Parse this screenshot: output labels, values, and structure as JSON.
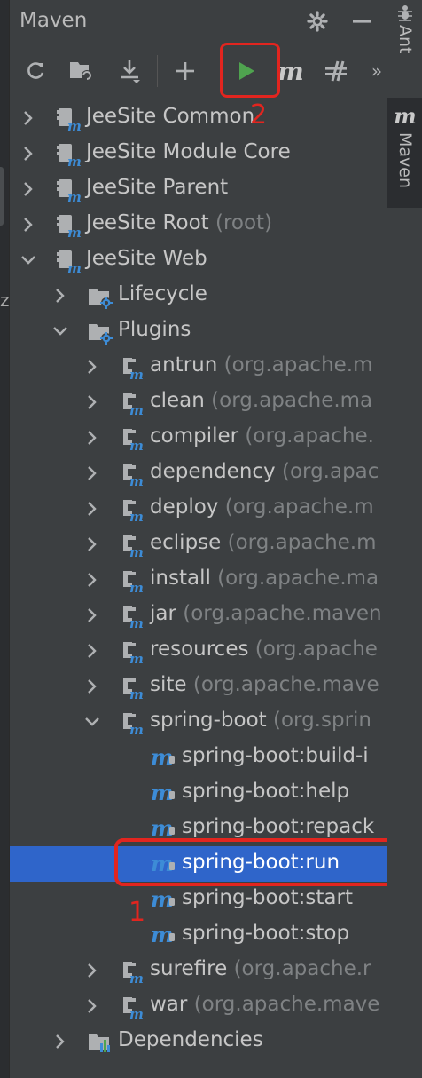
{
  "header": {
    "title": "Maven"
  },
  "toolbar": {
    "buttons": [
      "reload",
      "generate-sources",
      "download",
      "add",
      "run",
      "execute-goal",
      "skip-tests"
    ],
    "more": "»"
  },
  "left_strip": {
    "glyph": "z"
  },
  "side_tabs": [
    {
      "label": "Ant"
    },
    {
      "label": "Maven"
    }
  ],
  "tree": [
    {
      "label": "JeeSite Common",
      "sub": ""
    },
    {
      "label": "JeeSite Module Core",
      "sub": ""
    },
    {
      "label": "JeeSite Parent",
      "sub": ""
    },
    {
      "label": "JeeSite Root",
      "sub": "(root)"
    },
    {
      "label": "JeeSite Web",
      "sub": ""
    },
    {
      "label": "Lifecycle",
      "sub": ""
    },
    {
      "label": "Plugins",
      "sub": ""
    },
    {
      "label": "antrun",
      "sub": "(org.apache.m"
    },
    {
      "label": "clean",
      "sub": "(org.apache.ma"
    },
    {
      "label": "compiler",
      "sub": "(org.apache."
    },
    {
      "label": "dependency",
      "sub": "(org.apac"
    },
    {
      "label": "deploy",
      "sub": "(org.apache.m"
    },
    {
      "label": "eclipse",
      "sub": "(org.apache.m"
    },
    {
      "label": "install",
      "sub": "(org.apache.ma"
    },
    {
      "label": "jar",
      "sub": "(org.apache.maven"
    },
    {
      "label": "resources",
      "sub": "(org.apache"
    },
    {
      "label": "site",
      "sub": "(org.apache.mave"
    },
    {
      "label": "spring-boot",
      "sub": "(org.sprin"
    },
    {
      "label": "spring-boot:build-i",
      "sub": ""
    },
    {
      "label": "spring-boot:help",
      "sub": ""
    },
    {
      "label": "spring-boot:repack",
      "sub": ""
    },
    {
      "label": "spring-boot:run",
      "sub": ""
    },
    {
      "label": "spring-boot:start",
      "sub": ""
    },
    {
      "label": "spring-boot:stop",
      "sub": ""
    },
    {
      "label": "surefire",
      "sub": "(org.apache.r"
    },
    {
      "label": "war",
      "sub": "(org.apache.mave"
    },
    {
      "label": "Dependencies",
      "sub": ""
    }
  ],
  "annotations": {
    "first": "1",
    "second": "2"
  },
  "colors": {
    "selection": "#2f65ca",
    "annotation": "#e2251f",
    "run": "#4fa34f",
    "maven_blue": "#3d8cd6"
  }
}
